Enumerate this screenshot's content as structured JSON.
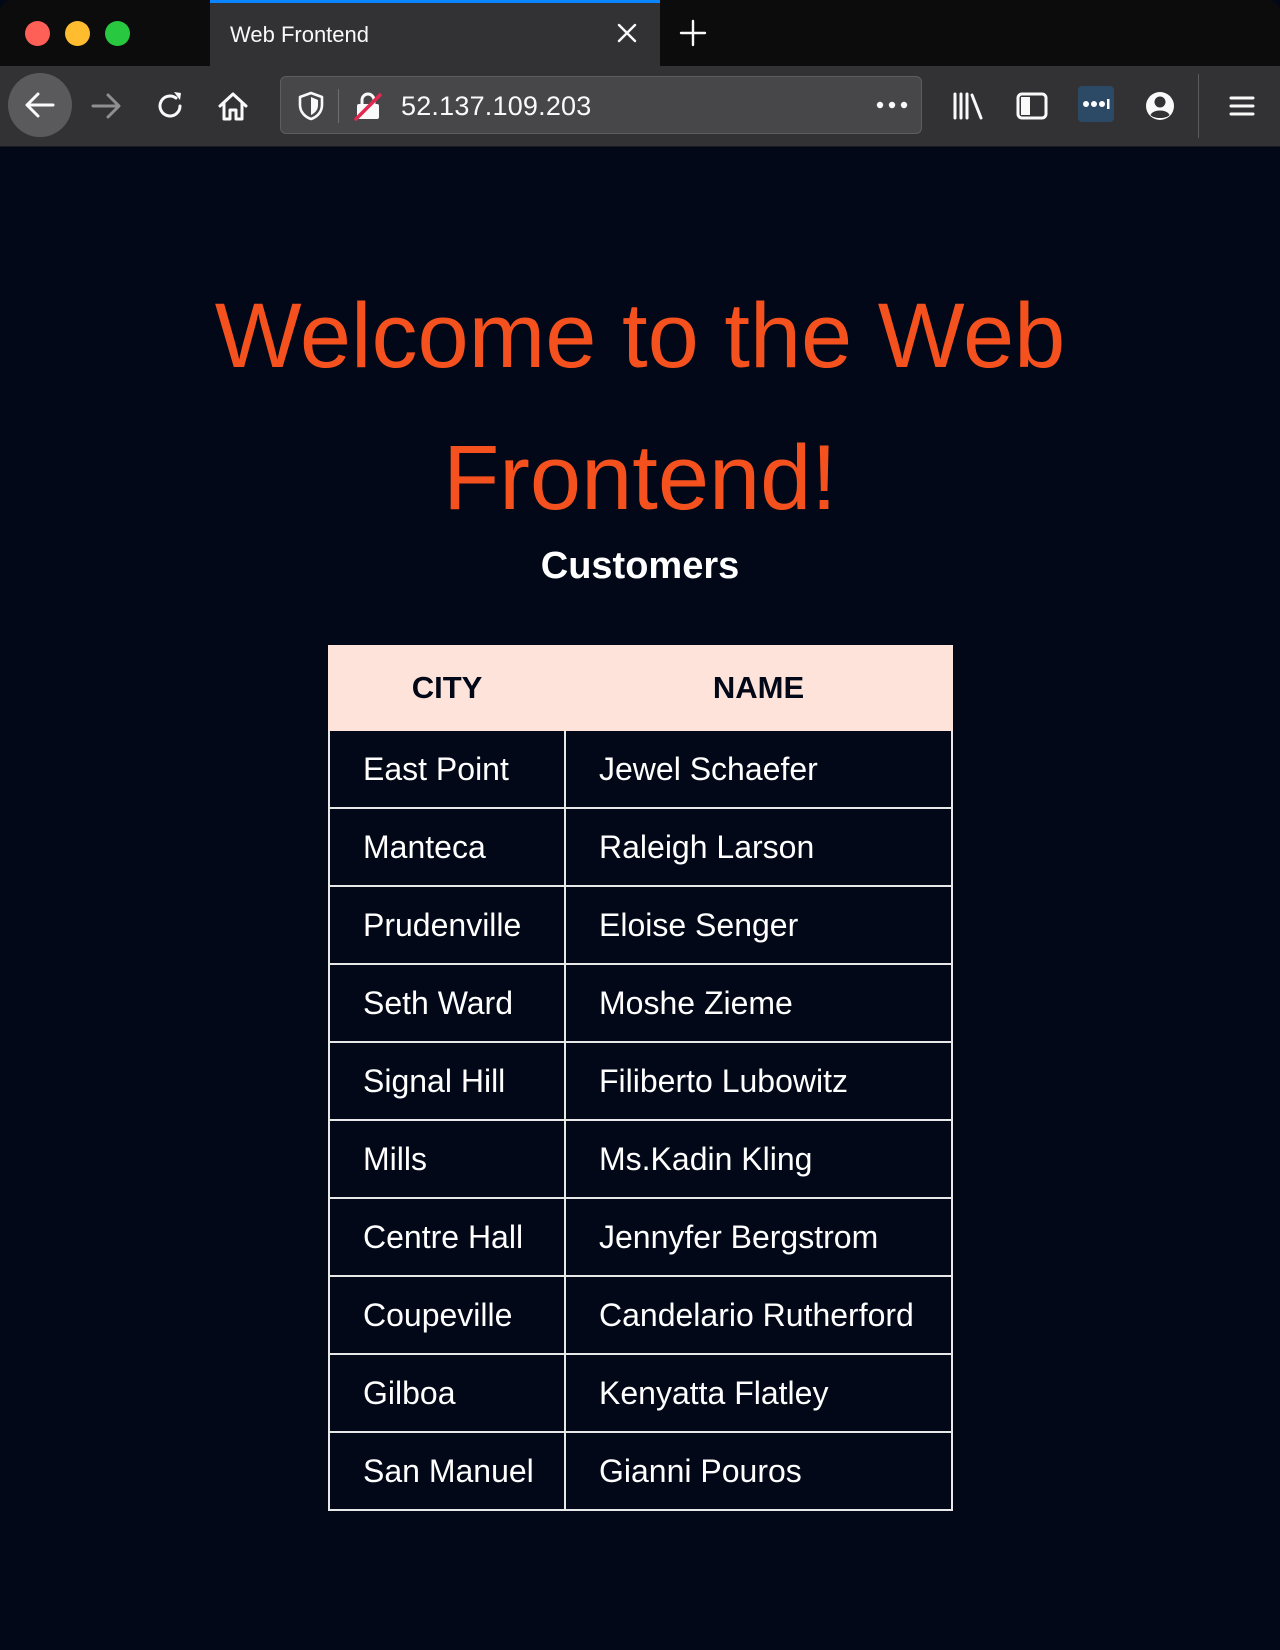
{
  "browser": {
    "tab_title": "Web Frontend",
    "url": "52.137.109.203"
  },
  "page": {
    "headline": "Welcome to the Web Frontend!",
    "subheading": "Customers",
    "table": {
      "columns": [
        "CITY",
        "NAME"
      ],
      "rows": [
        {
          "city": "East Point",
          "name": "Jewel Schaefer"
        },
        {
          "city": "Manteca",
          "name": "Raleigh Larson"
        },
        {
          "city": "Prudenville",
          "name": "Eloise Senger"
        },
        {
          "city": "Seth Ward",
          "name": "Moshe Zieme"
        },
        {
          "city": "Signal Hill",
          "name": "Filiberto Lubowitz"
        },
        {
          "city": "Mills",
          "name": "Ms.Kadin Kling"
        },
        {
          "city": "Centre Hall",
          "name": "Jennyfer Bergstrom"
        },
        {
          "city": "Coupeville",
          "name": "Candelario Rutherford"
        },
        {
          "city": "Gilboa",
          "name": "Kenyatta Flatley"
        },
        {
          "city": "San Manuel",
          "name": "Gianni Pouros"
        }
      ]
    }
  },
  "colors": {
    "page_background": "#020817",
    "headline": "#f4511e",
    "table_header_background": "#fde3da",
    "tab_accent": "#0a84ff"
  },
  "icons": {
    "window_controls": [
      "close-dot",
      "minimize-dot",
      "zoom-dot"
    ],
    "tab": [
      "close-icon",
      "plus-icon"
    ],
    "navigation": [
      "back-arrow-icon",
      "forward-arrow-icon",
      "reload-icon",
      "home-icon"
    ],
    "urlbar": [
      "shield-icon",
      "insecure-lock-icon",
      "more-dots-icon"
    ],
    "toolbar": [
      "library-icon",
      "sidebar-icon",
      "extension-icon",
      "account-icon",
      "hamburger-menu-icon"
    ]
  }
}
